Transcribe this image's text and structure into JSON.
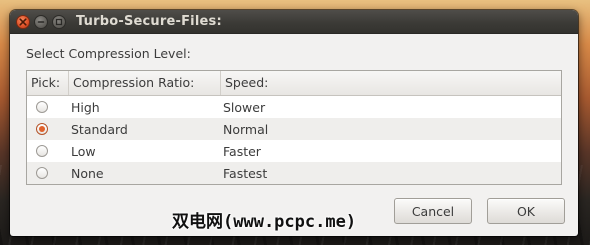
{
  "window": {
    "title": "Turbo-Secure-Files:",
    "controls": [
      "close-icon",
      "minimize-icon",
      "maximize-icon"
    ]
  },
  "dialog": {
    "prompt": "Select Compression Level:",
    "columns": [
      "Pick:",
      "Compression Ratio:",
      "Speed:"
    ],
    "rows": [
      {
        "ratio": "High",
        "speed": "Slower",
        "selected": false
      },
      {
        "ratio": "Standard",
        "speed": "Normal",
        "selected": true
      },
      {
        "ratio": "Low",
        "speed": "Faster",
        "selected": false
      },
      {
        "ratio": "None",
        "speed": "Fastest",
        "selected": false
      }
    ]
  },
  "buttons": {
    "cancel": "Cancel",
    "ok": "OK"
  },
  "watermark": "双电网(www.pcpc.me)",
  "colors": {
    "accent": "#e0622c",
    "titlebar": "#3c3b37",
    "dialog_bg": "#f2f1f0"
  }
}
